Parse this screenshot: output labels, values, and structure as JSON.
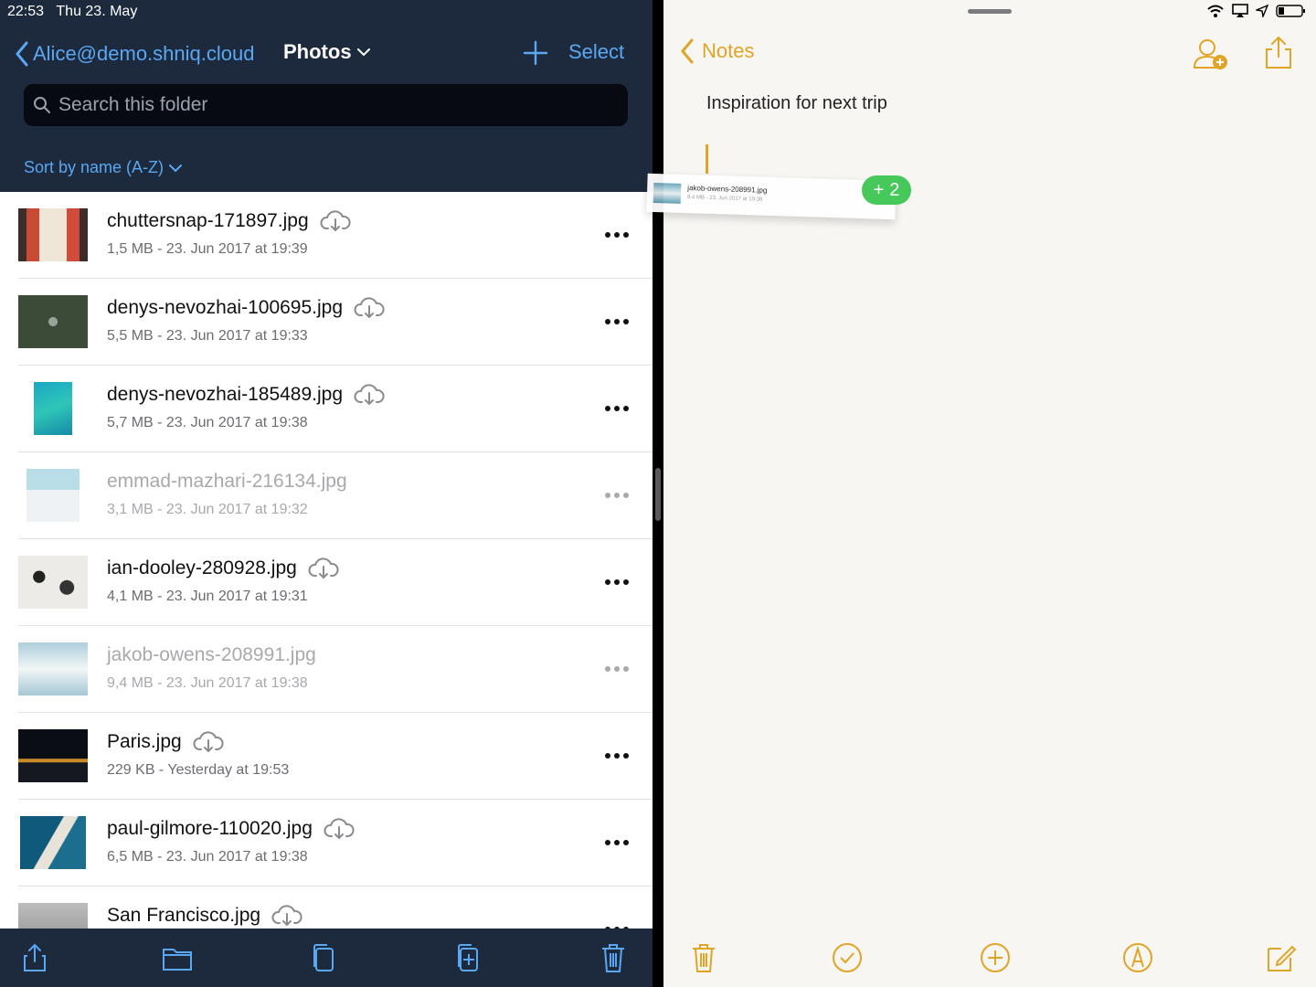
{
  "status_bar": {
    "time": "22:53",
    "date": "Thu 23. May"
  },
  "files_app": {
    "back_label": "Alice@demo.shniq.cloud",
    "folder_title": "Photos",
    "select_label": "Select",
    "search_placeholder": "Search this folder",
    "sort_label": "Sort by name (A-Z)",
    "files": [
      {
        "name": "chuttersnap-171897.jpg",
        "meta": "1,5 MB - 23. Jun 2017 at 19:39",
        "cloud": true,
        "dimmed": false
      },
      {
        "name": "denys-nevozhai-100695.jpg",
        "meta": "5,5 MB - 23. Jun 2017 at 19:33",
        "cloud": true,
        "dimmed": false
      },
      {
        "name": "denys-nevozhai-185489.jpg",
        "meta": "5,7 MB - 23. Jun 2017 at 19:38",
        "cloud": true,
        "dimmed": false
      },
      {
        "name": "emmad-mazhari-216134.jpg",
        "meta": "3,1 MB - 23. Jun 2017 at 19:32",
        "cloud": false,
        "dimmed": true
      },
      {
        "name": "ian-dooley-280928.jpg",
        "meta": "4,1 MB - 23. Jun 2017 at 19:31",
        "cloud": true,
        "dimmed": false
      },
      {
        "name": "jakob-owens-208991.jpg",
        "meta": "9,4 MB - 23. Jun 2017 at 19:38",
        "cloud": false,
        "dimmed": true
      },
      {
        "name": "Paris.jpg",
        "meta": "229 KB - Yesterday at 19:53",
        "cloud": true,
        "dimmed": false
      },
      {
        "name": "paul-gilmore-110020.jpg",
        "meta": "6,5 MB - 23. Jun 2017 at 19:38",
        "cloud": true,
        "dimmed": false
      },
      {
        "name": "San Francisco.jpg",
        "meta": "",
        "cloud": true,
        "dimmed": false
      }
    ]
  },
  "notes_app": {
    "back_label": "Notes",
    "note_title": "Inspiration for next trip"
  },
  "drag_preview": {
    "name": "jakob-owens-208991.jpg",
    "meta": "9,4 MB - 23. Jun 2017 at 19:38",
    "badge_count": "2"
  },
  "colors": {
    "header_bg": "#1d2a3d",
    "link_blue": "#5aa7f2",
    "notes_accent": "#e0a526",
    "badge_green": "#46c85a"
  }
}
